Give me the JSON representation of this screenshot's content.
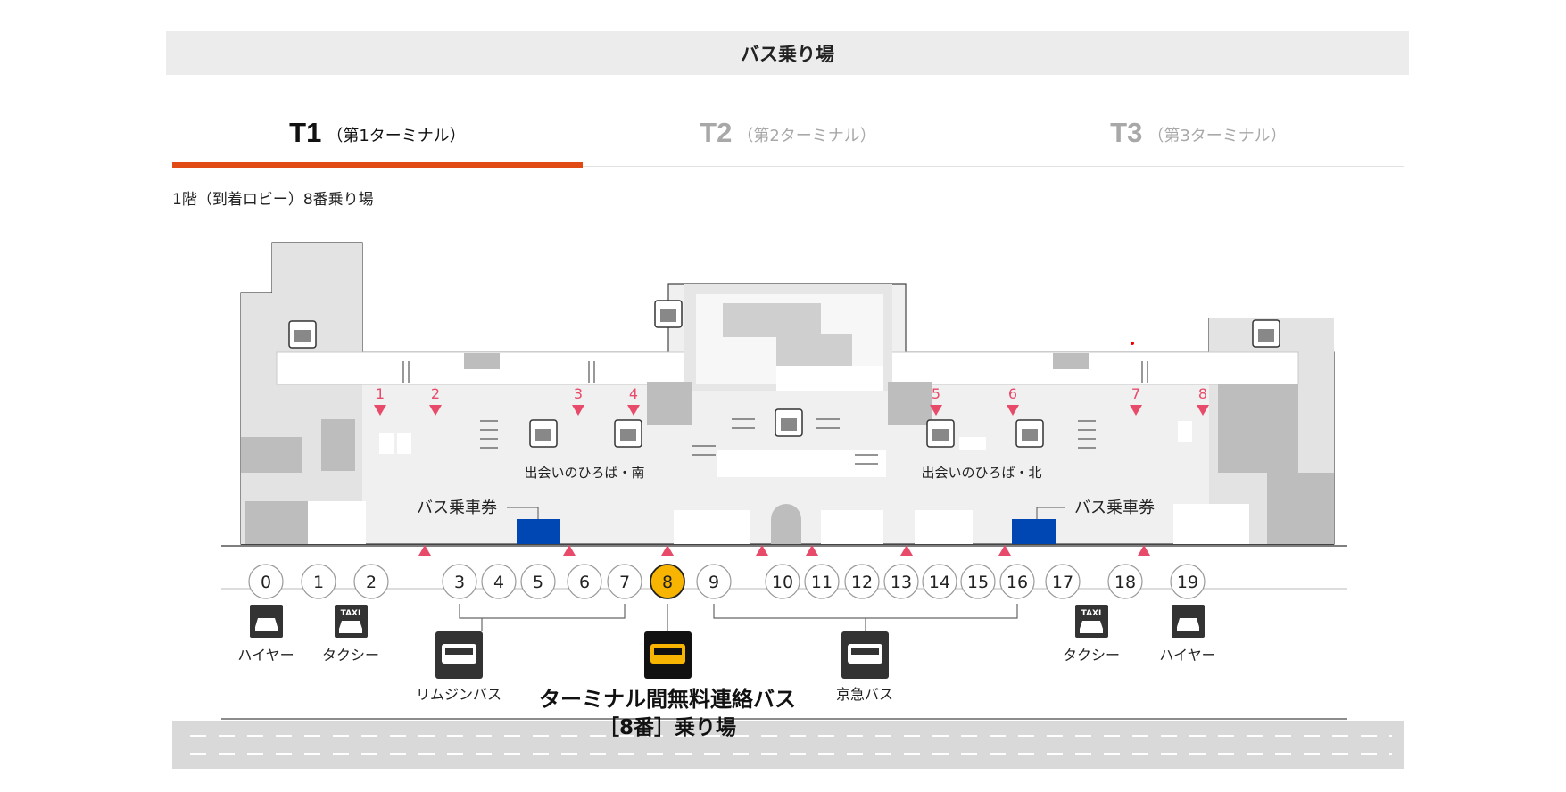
{
  "header": {
    "title": "バス乗り場"
  },
  "tabs": [
    {
      "code": "T1",
      "sub": "（第1ターミナル）",
      "active": true
    },
    {
      "code": "T2",
      "sub": "（第2ターミナル）",
      "active": false
    },
    {
      "code": "T3",
      "sub": "（第3ターミナル）",
      "active": false
    }
  ],
  "floor_label": "1階（到着ロビー）8番乗り場",
  "colors": {
    "accent": "#e24a15",
    "highlight_stop": "#f7b400",
    "ticket_counter": "#0047b3",
    "exit_marker": "#e84b6a",
    "icon_dark": "#333333"
  },
  "map": {
    "plaza_south": "出会いのひろば・南",
    "plaza_north": "出会いのひろば・北",
    "ticket_south": "バス乗車券",
    "ticket_north": "バス乗車券",
    "exits": [
      "1",
      "2",
      "3",
      "4",
      "5",
      "6",
      "7",
      "8"
    ],
    "stops": [
      "0",
      "1",
      "2",
      "3",
      "4",
      "5",
      "6",
      "7",
      "8",
      "9",
      "10",
      "11",
      "12",
      "13",
      "14",
      "15",
      "16",
      "17",
      "18",
      "19"
    ],
    "highlighted_stop": "8",
    "services": {
      "hire_left": "ハイヤー",
      "taxi_left": "タクシー",
      "limousine": "リムジンバス",
      "keikyu": "京急バス",
      "taxi_right": "タクシー",
      "hire_right": "ハイヤー",
      "taxi_sign": "TAXI"
    },
    "free_bus_title": "ターミナル間無料連絡バス",
    "free_bus_subtitle": "［8番］乗り場"
  }
}
